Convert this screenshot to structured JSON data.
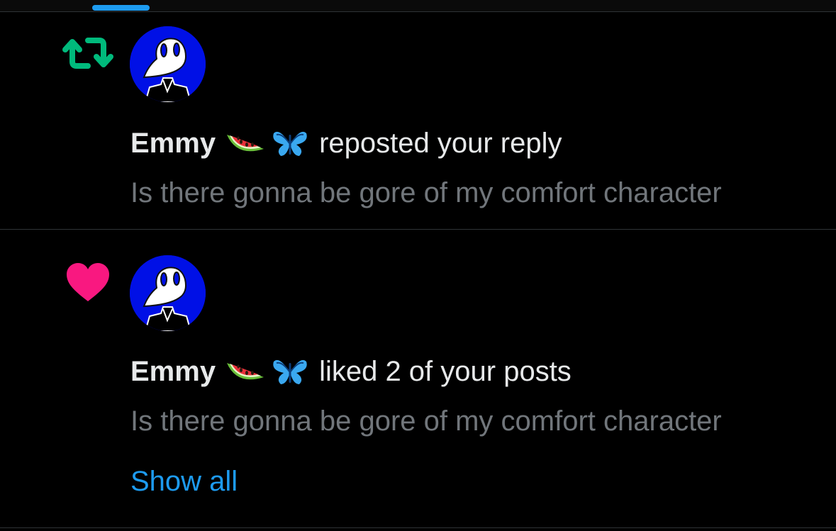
{
  "colors": {
    "background": "#000000",
    "text_primary": "#e7e9ea",
    "text_secondary": "#71767b",
    "accent": "#1d9bf0",
    "repost_green": "#00ba7c",
    "like_pink": "#f91880",
    "avatar_blue": "#0010e6"
  },
  "tabs": {
    "active_indicator": "active-tab-indicator"
  },
  "notifications": [
    {
      "type": "repost",
      "icon": "repost-icon",
      "user": {
        "name": "Emmy",
        "emojis": [
          "watermelon-emoji",
          "butterfly-emoji"
        ],
        "avatar": "plague-doctor-mask-avatar"
      },
      "action": "reposted your reply",
      "preview": "Is there gonna be gore of my comfort character"
    },
    {
      "type": "like",
      "icon": "heart-icon",
      "user": {
        "name": "Emmy",
        "emojis": [
          "watermelon-emoji",
          "butterfly-emoji"
        ],
        "avatar": "plague-doctor-mask-avatar"
      },
      "action": "liked 2 of your posts",
      "preview": "Is there gonna be gore of my comfort character",
      "show_all_label": "Show all"
    }
  ]
}
